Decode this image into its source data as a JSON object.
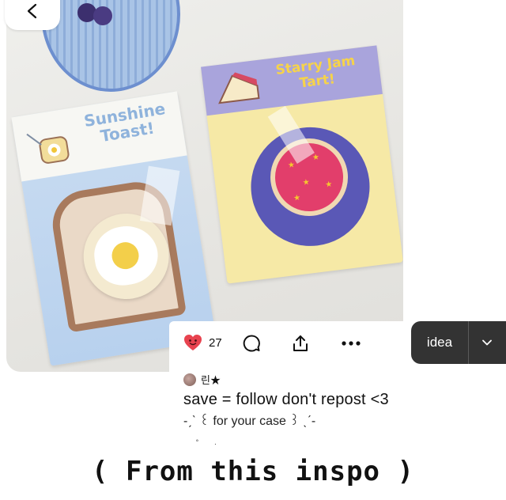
{
  "photo": {
    "toast_card_text": "Sunshine Toast!",
    "tart_card_text": "Starry Jam Tart!"
  },
  "pin_actions": {
    "reaction_count": "27",
    "comment_icon": "comment-bubble-icon",
    "share_icon": "share-upload-icon",
    "more_icon": "more-dots-icon",
    "save_menu_label": "idea"
  },
  "author": {
    "name": "린★"
  },
  "caption": "save = follow don't repost <3",
  "subcaption": "-ˏˋ ꒰ for your case ꒱ ˎˊ-",
  "overlay_text": "( From this inspo )",
  "colors": {
    "heart": "#e8434f",
    "idea_button": "#333333"
  }
}
